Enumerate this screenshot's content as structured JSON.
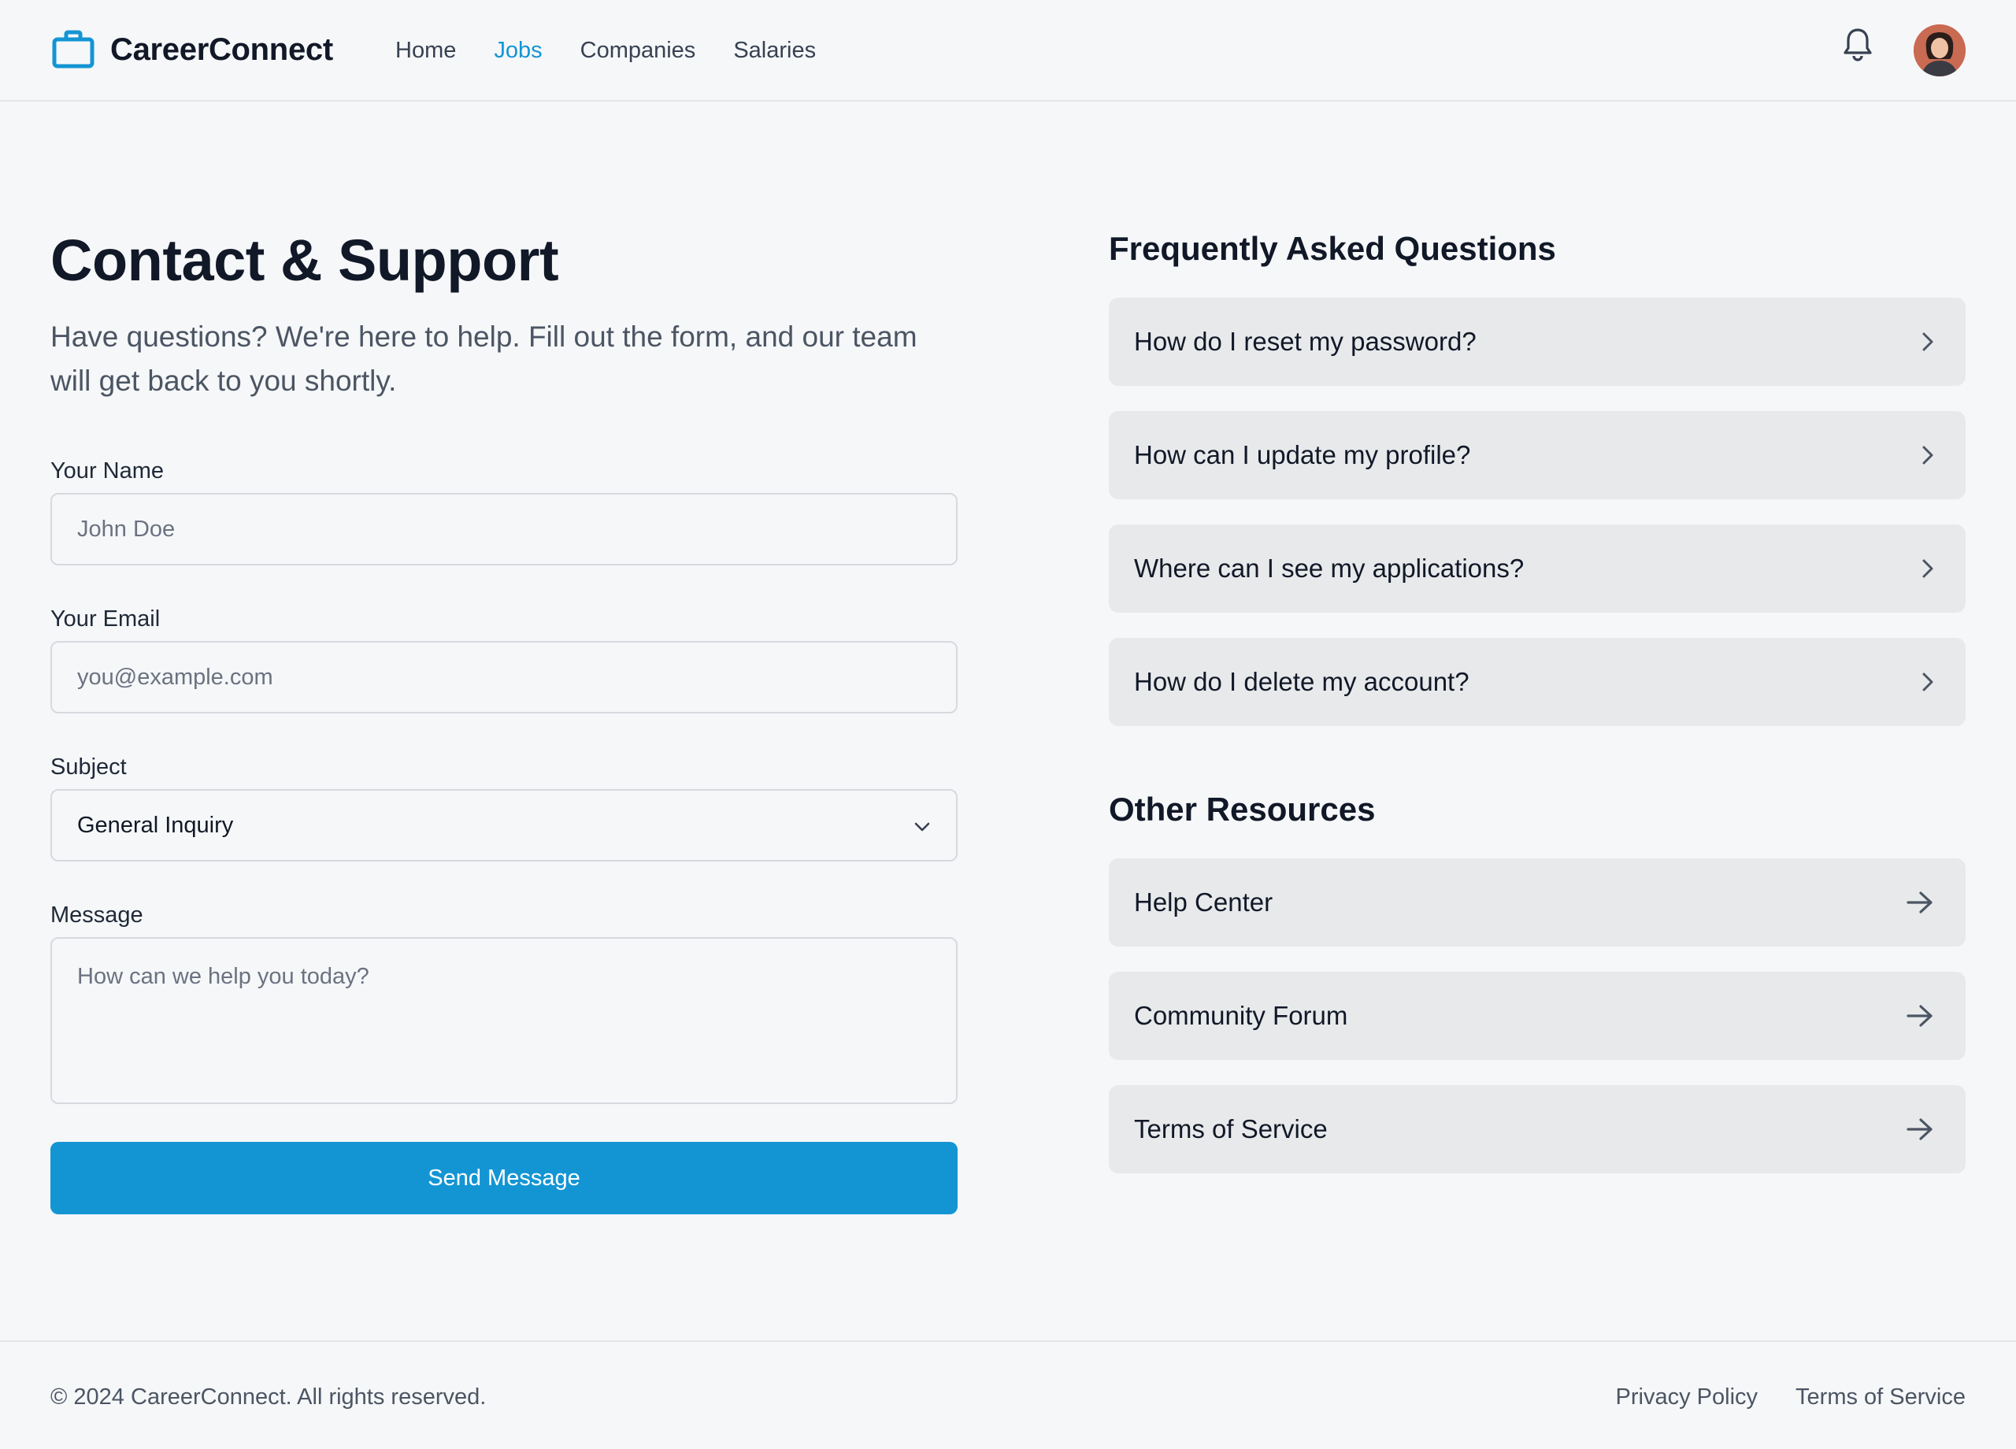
{
  "header": {
    "brand": "CareerConnect",
    "nav": [
      {
        "label": "Home",
        "active": false
      },
      {
        "label": "Jobs",
        "active": true
      },
      {
        "label": "Companies",
        "active": false
      },
      {
        "label": "Salaries",
        "active": false
      }
    ],
    "icons": {
      "logo": "briefcase-icon",
      "notifications": "bell-icon",
      "avatar": "user-avatar"
    }
  },
  "main": {
    "title": "Contact & Support",
    "subtitle": "Have questions? We're here to help. Fill out the form, and our team will get back to you shortly.",
    "form": {
      "name": {
        "label": "Your Name",
        "placeholder": "John Doe",
        "value": ""
      },
      "email": {
        "label": "Your Email",
        "placeholder": "you@example.com",
        "value": ""
      },
      "subject": {
        "label": "Subject",
        "value": "General Inquiry"
      },
      "message": {
        "label": "Message",
        "placeholder": "How can we help you today?",
        "value": ""
      },
      "submit_label": "Send Message"
    }
  },
  "faq": {
    "title": "Frequently Asked Questions",
    "items": [
      {
        "label": "How do I reset my password?"
      },
      {
        "label": "How can I update my profile?"
      },
      {
        "label": "Where can I see my applications?"
      },
      {
        "label": "How do I delete my account?"
      }
    ]
  },
  "resources": {
    "title": "Other Resources",
    "items": [
      {
        "label": "Help Center"
      },
      {
        "label": "Community Forum"
      },
      {
        "label": "Terms of Service"
      }
    ]
  },
  "footer": {
    "copyright": "© 2024 CareerConnect. All rights reserved.",
    "links": [
      "Privacy Policy",
      "Terms of Service"
    ]
  },
  "colors": {
    "accent": "#1395d4",
    "background": "#f6f7f9",
    "card": "#e8e9eb",
    "text": "#111827"
  }
}
